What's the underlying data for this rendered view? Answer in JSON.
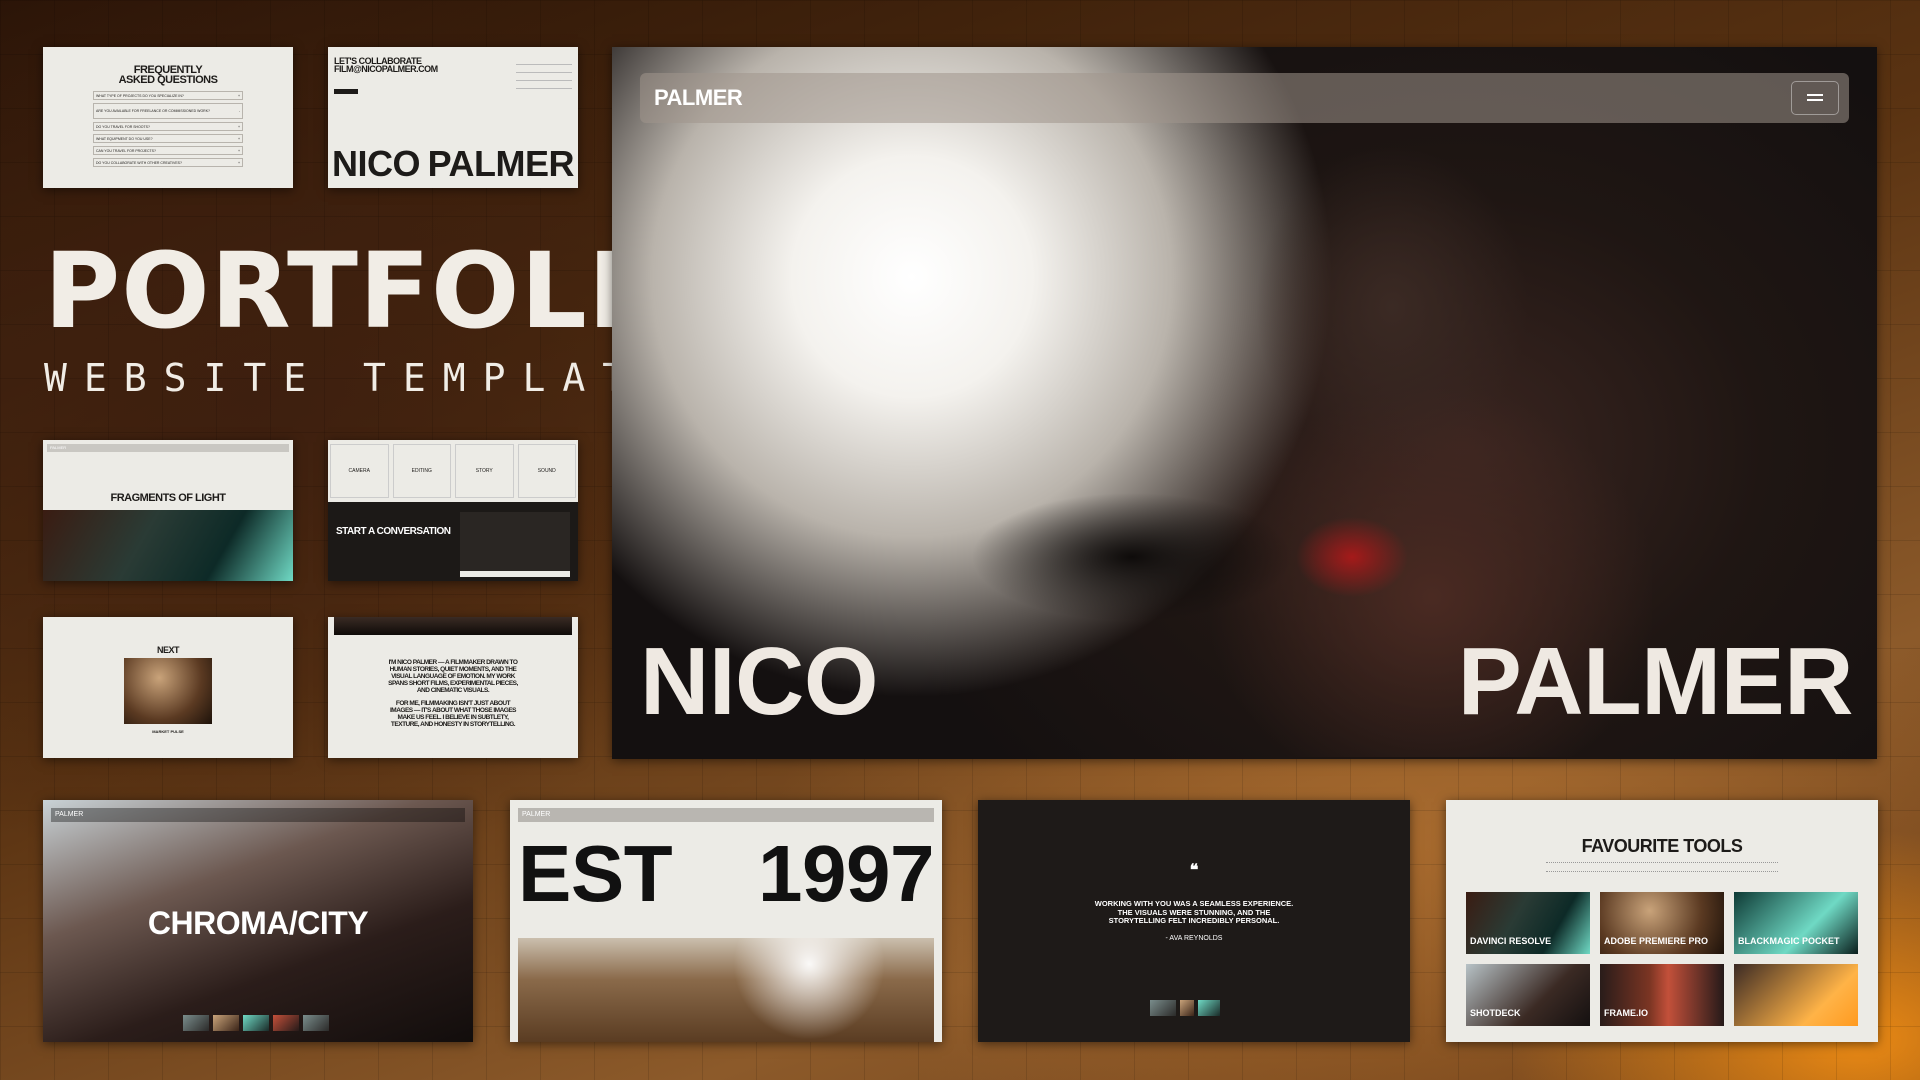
{
  "hero": {
    "title": "PORTFOLIO",
    "subtitle": "WEBSITE TEMPLATE"
  },
  "faq": {
    "title_line1": "FREQUENTLY",
    "title_line2": "ASKED QUESTIONS",
    "questions": [
      "WHAT TYPE OF PROJECTS DO YOU SPECIALIZE IN?",
      "ARE YOU AVAILABLE FOR FREELANCE OR COMMISSIONED WORK?",
      "DO YOU TRAVEL FOR SHOOTS?",
      "WHAT EQUIPMENT DO YOU USE?",
      "CAN YOU TRAVEL FOR PROJECTS?",
      "DO YOU COLLABORATE WITH OTHER CREATIVES?"
    ]
  },
  "contact": {
    "heading_line1": "LET'S COLLABORATE",
    "heading_line2": "FILM@NICOPALMER.COM",
    "name_left": "NICO",
    "name_right": "PALMER"
  },
  "fragments": {
    "brand": "PALMER",
    "title": "FRAGMENTS OF LIGHT"
  },
  "services": {
    "tabs": [
      "CAMERA",
      "EDITING",
      "STORY",
      "SOUND"
    ],
    "cta": "START A CONVERSATION"
  },
  "next_card": {
    "label": "NEXT",
    "caption": "MARKET PULSE"
  },
  "bio": {
    "paragraph1": "I'M NICO PALMER — A FILMMAKER DRAWN TO HUMAN STORIES, QUIET MOMENTS, AND THE VISUAL LANGUAGE OF EMOTION. MY WORK SPANS SHORT FILMS, EXPERIMENTAL PIECES, AND CINEMATIC VISUALS.",
    "paragraph2": "FOR ME, FILMMAKING ISN'T JUST ABOUT IMAGES — IT'S ABOUT WHAT THOSE IMAGES MAKE US FEEL. I BELIEVE IN SUBTLETY, TEXTURE, AND HONESTY IN STORYTELLING."
  },
  "main_preview": {
    "brand": "PALMER",
    "name_left": "NICO",
    "name_right": "PALMER",
    "menu_icon": "hamburger-icon"
  },
  "chroma": {
    "brand": "PALMER",
    "title": "CHROMA/CITY"
  },
  "est": {
    "brand": "PALMER",
    "left": "EST",
    "right": "1997"
  },
  "testimonial": {
    "quote": "WORKING WITH YOU WAS A SEAMLESS EXPERIENCE. THE VISUALS WERE STUNNING, AND THE STORYTELLING FELT INCREDIBLY PERSONAL.",
    "author": "- AVA REYNOLDS"
  },
  "tools": {
    "title": "FAVOURITE TOOLS",
    "items": [
      {
        "name": "DAVINCI RESOLVE"
      },
      {
        "name": "ADOBE PREMIERE PRO"
      },
      {
        "name": "BLACKMAGIC POCKET"
      },
      {
        "name": "SHOTDECK"
      },
      {
        "name": "FRAME.IO"
      },
      {
        "name": ""
      }
    ]
  },
  "colors": {
    "cream": "#ecebe6",
    "ink": "#1d1b19",
    "dark": "#1c1917",
    "accent_orange": "#ff9a1f"
  }
}
